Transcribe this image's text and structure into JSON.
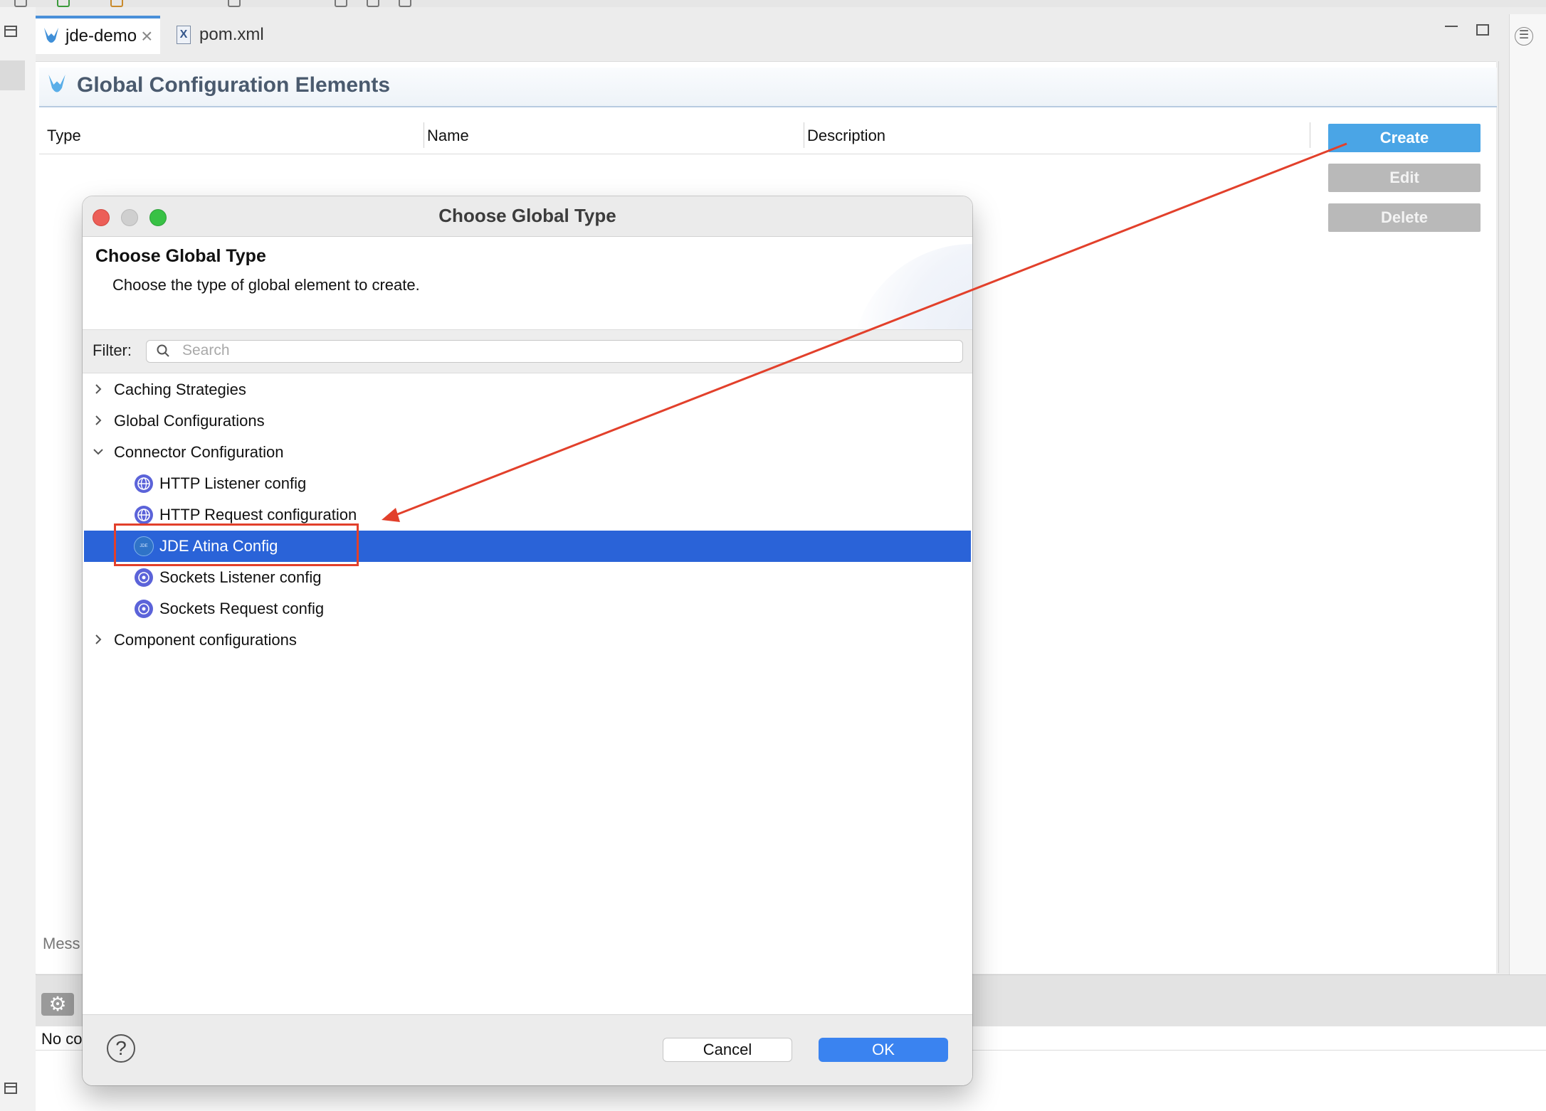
{
  "tabs": [
    {
      "label": "jde-demo",
      "close": "×",
      "icon": "mule-icon",
      "active": true
    },
    {
      "label": "pom.xml",
      "icon": "xml-file-icon",
      "active": false
    }
  ],
  "xml_icon_letter": "X",
  "editor": {
    "title": "Global Configuration Elements",
    "columns": [
      "Type",
      "Name",
      "Description"
    ],
    "buttons": {
      "create": "Create",
      "edit": "Edit",
      "delete": "Delete"
    },
    "messages_label": "Mess"
  },
  "bottom": {
    "no_config_label": "No co"
  },
  "right_panel_icon": "☰",
  "dialog": {
    "window_title": "Choose Global Type",
    "heading": "Choose Global Type",
    "description": "Choose the type of global element to create.",
    "filter_label": "Filter:",
    "search_placeholder": "Search",
    "tree": [
      {
        "label": "Caching Strategies",
        "expanded": false
      },
      {
        "label": "Global Configurations",
        "expanded": false
      },
      {
        "label": "Connector Configuration",
        "expanded": true,
        "children": [
          {
            "label": "HTTP Listener config",
            "icon": "http-globe-icon"
          },
          {
            "label": "HTTP Request configuration",
            "icon": "http-globe-icon"
          },
          {
            "label": "JDE Atina Config",
            "icon": "jde-connector-icon",
            "selected": true,
            "icon_text": "JDE"
          },
          {
            "label": "Sockets Listener config",
            "icon": "sockets-globe-icon"
          },
          {
            "label": "Sockets Request config",
            "icon": "sockets-globe-icon"
          }
        ]
      },
      {
        "label": "Component configurations",
        "expanded": false
      }
    ],
    "help": "?",
    "cancel": "Cancel",
    "ok": "OK"
  },
  "gear_glyph": "⚙",
  "colors": {
    "selection": "#2a63d8",
    "annotation_red": "#e2402b",
    "create_button": "#4aa5e6",
    "ok_button": "#3a83f0"
  }
}
